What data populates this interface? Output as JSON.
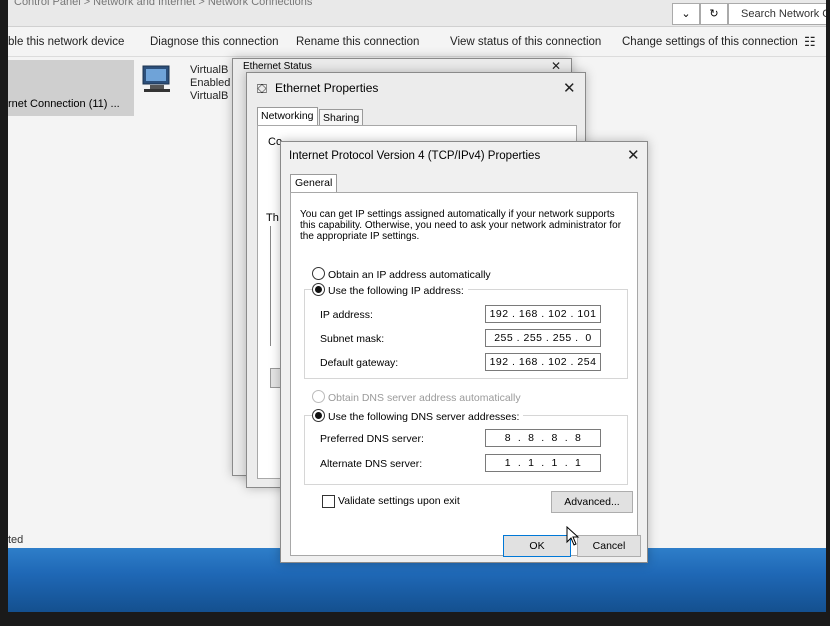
{
  "explorer": {
    "address_text": "Control Panel  >  Network and Internet  >  Network Connections",
    "refresh_icon": "refresh-icon",
    "search_placeholder": "Search Network Connections",
    "commands": [
      "ble this network device",
      "Diagnose this connection",
      "Rename this connection",
      "View status of this connection",
      "Change settings of this connection"
    ],
    "selected_connection_label": "rnet Connection (11) ...",
    "vbox_line1": "VirtualB",
    "vbox_line2": "Enabled",
    "vbox_line3": "VirtualB",
    "status_fragment": "ted"
  },
  "ethernet_status": {
    "title": "Ethernet Status"
  },
  "ethernet_properties": {
    "title": "Ethernet Properties",
    "tabs": [
      "Networking",
      "Sharing"
    ],
    "frag_co": "Co",
    "frag_th": "Th"
  },
  "ipv4": {
    "title": "Internet Protocol Version 4 (TCP/IPv4) Properties",
    "tab": "General",
    "intro": "You can get IP settings assigned automatically if your network supports this capability. Otherwise, you need to ask your network administrator for the appropriate IP settings.",
    "obtain_ip_auto": "Obtain an IP address automatically",
    "use_following_ip": "Use the following IP address:",
    "ip_address_label": "IP address:",
    "ip_address": "192 . 168 . 102 . 101",
    "subnet_label": "Subnet mask:",
    "subnet_mask": "255 . 255 . 255 .  0",
    "gateway_label": "Default gateway:",
    "gateway": "192 . 168 . 102 . 254",
    "obtain_dns_auto": "Obtain DNS server address automatically",
    "use_following_dns": "Use the following DNS server addresses:",
    "preferred_dns_label": "Preferred DNS server:",
    "preferred_dns": "8  .  8  .  8  .  8",
    "alternate_dns_label": "Alternate DNS server:",
    "alternate_dns": "1  .  1  .  1  .  1",
    "validate_label": "Validate settings upon exit",
    "advanced_button": "Advanced...",
    "ok_button": "OK",
    "cancel_button": "Cancel",
    "ip_mode": "manual",
    "dns_mode": "manual",
    "validate_checked": false
  }
}
